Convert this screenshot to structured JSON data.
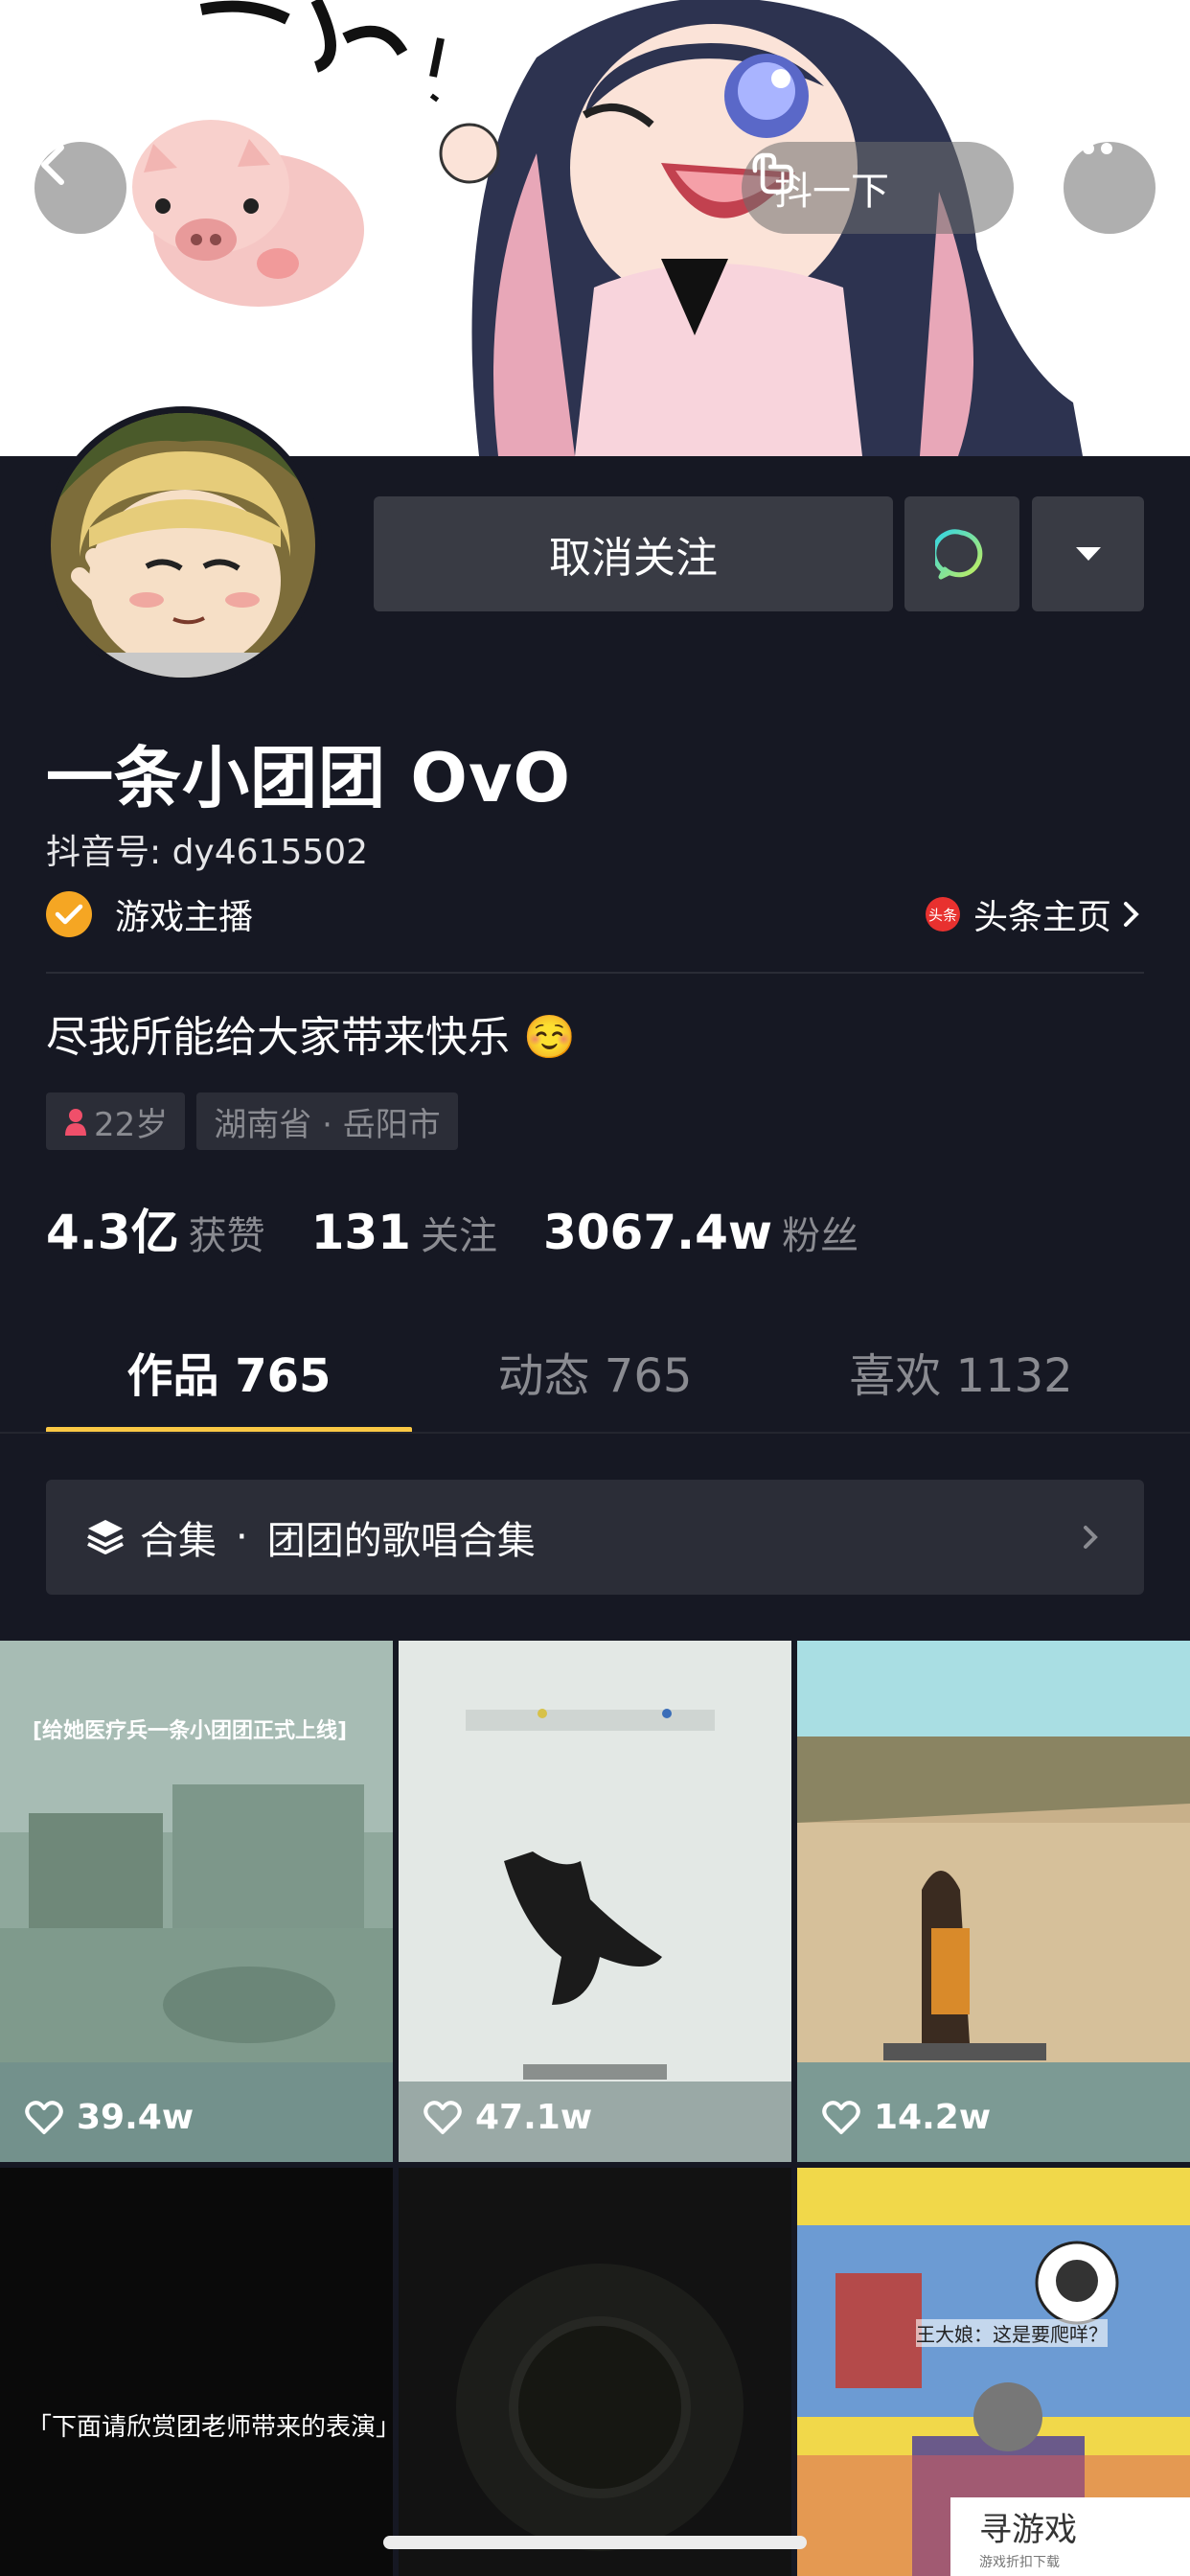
{
  "banner": {
    "shake_label": "抖一下",
    "icons": {
      "back": "chevron-left-icon",
      "more": "more-dots-icon",
      "shake": "hand-tap-icon"
    }
  },
  "profile": {
    "unfollow_label": "取消关注",
    "name": "一条小团团 OvO",
    "douyin_id": "抖音号: dy4615502",
    "verification": "游戏主播",
    "toutiao_logo_text": "头条",
    "toutiao_link": "头条主页",
    "bio": "尽我所能给大家带来快乐 ☺️",
    "tags": {
      "age": "22岁",
      "location": "湖南省 · 岳阳市"
    },
    "stats": [
      {
        "value": "4.3亿",
        "label": "获赞"
      },
      {
        "value": "131",
        "label": "关注"
      },
      {
        "value": "3067.4w",
        "label": "粉丝"
      }
    ]
  },
  "tabs": [
    {
      "label": "作品 765",
      "active": true
    },
    {
      "label": "动态 765",
      "active": false
    },
    {
      "label": "喜欢 1132",
      "active": false
    }
  ],
  "collection": {
    "title": "合集",
    "separator": "·",
    "name": "团团的歌唱合集"
  },
  "videos": [
    {
      "caption": "[给她医疗兵一条小团团正式上线]",
      "likes": "39.4w"
    },
    {
      "caption": "",
      "likes": "47.1w"
    },
    {
      "caption": "",
      "likes": "14.2w"
    },
    {
      "caption": "「下面请欣赏团老师带来的表演」",
      "likes": ""
    },
    {
      "caption": "",
      "likes": ""
    },
    {
      "caption": "王大娘：这是要爬咩？",
      "likes": ""
    }
  ],
  "ad": {
    "label": "寻游戏",
    "sub": "游戏折扣下载"
  },
  "colors": {
    "background": "#161823",
    "accent": "#fbc844",
    "button": "#393b44",
    "badge": "#f5a623"
  }
}
